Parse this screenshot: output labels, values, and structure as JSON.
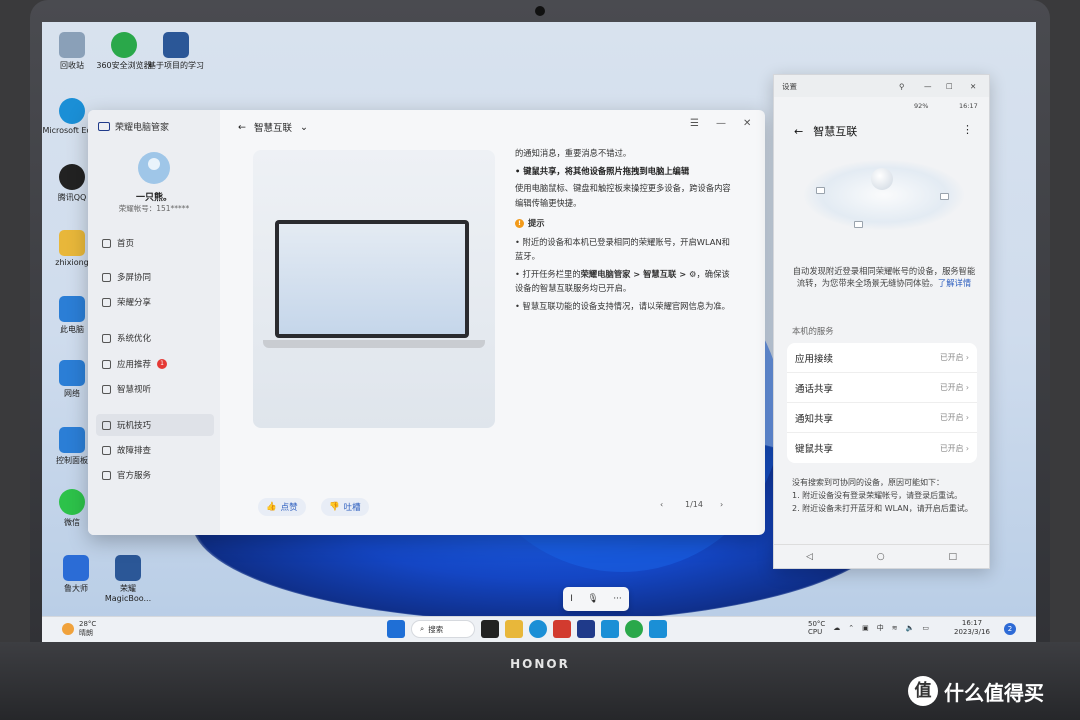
{
  "device": {
    "brand": "HONOR"
  },
  "desktop_icons": [
    {
      "label": "回收站",
      "icon": "recycle-bin-icon",
      "color": "#8aa0b8"
    },
    {
      "label": "360安全浏览器",
      "icon": "browser-icon",
      "color": "#2aa84a"
    },
    {
      "label": "基于项目的学习",
      "icon": "word-doc-icon",
      "color": "#2b5797"
    },
    {
      "label": "Microsoft Edge",
      "icon": "edge-icon",
      "color": "#1b8fd6"
    },
    {
      "label": "腾讯QQ",
      "icon": "qq-icon",
      "color": "#222"
    },
    {
      "label": "zhixiong",
      "icon": "folder-icon",
      "color": "#e8b73a"
    },
    {
      "label": "此电脑",
      "icon": "computer-icon",
      "color": "#2b7ed6"
    },
    {
      "label": "网络",
      "icon": "network-icon",
      "color": "#2b7ed6"
    },
    {
      "label": "控制面板",
      "icon": "control-panel-icon",
      "color": "#2b7ed6"
    },
    {
      "label": "微信",
      "icon": "wechat-icon",
      "color": "#2dc24a"
    },
    {
      "label": "鲁大师",
      "icon": "ludashi-icon",
      "color": "#2b6cd6"
    },
    {
      "label": "荣耀 MagicBoo...",
      "icon": "word-doc-icon",
      "color": "#2b5797"
    }
  ],
  "app": {
    "title": "荣耀电脑管家",
    "user_name": "一只熊。",
    "user_id": "荣耀帐号：151*****",
    "nav": [
      {
        "label": "首页",
        "icon": "home-icon"
      },
      {
        "label": "多屏协同",
        "icon": "multi-screen-icon"
      },
      {
        "label": "荣耀分享",
        "icon": "share-icon"
      },
      {
        "label": "系统优化",
        "icon": "optimize-icon"
      },
      {
        "label": "应用推荐",
        "icon": "apps-icon",
        "badge": "1"
      },
      {
        "label": "智慧视听",
        "icon": "audio-visual-icon"
      },
      {
        "label": "玩机技巧",
        "icon": "tips-icon",
        "active": true
      },
      {
        "label": "故障排查",
        "icon": "troubleshoot-icon"
      },
      {
        "label": "官方服务",
        "icon": "service-icon"
      }
    ],
    "header": "智慧互联",
    "article": {
      "line0": "的通知消息，重要消息不错过。",
      "heading": "键鼠共享，将其他设备照片拖拽到电脑上编辑",
      "body": "使用电脑鼠标、键盘和触控板来操控更多设备，跨设备内容编辑传输更快捷。",
      "tip_title": "提示",
      "tip1": "附近的设备和本机已登录相同的荣耀账号，开启WLAN和蓝牙。",
      "tip2_a": "打开任务栏里的",
      "tip2_b": "荣耀电脑管家 > 智慧互联 > ⚙",
      "tip2_c": "，确保该设备的智慧互联服务均已开启。",
      "tip3": "智慧互联功能的设备支持情况，请以荣耀官网信息为准。"
    },
    "like_label": "点赞",
    "dislike_label": "吐槽",
    "page": "1/14"
  },
  "settings": {
    "window_title": "设置",
    "battery": "92%",
    "time": "16:17",
    "title": "智慧互联",
    "desc": "自动发现附近登录相同荣耀帐号的设备，服务智能流转，为您带来全场景无缝协同体验。",
    "learn_more": "了解详情",
    "section": "本机的服务",
    "services": [
      {
        "label": "应用接续",
        "status": "已开启"
      },
      {
        "label": "通话共享",
        "status": "已开启"
      },
      {
        "label": "通知共享",
        "status": "已开启"
      },
      {
        "label": "键鼠共享",
        "status": "已开启"
      }
    ],
    "note_title": "没有搜索到可协同的设备，原因可能如下：",
    "note1": "1. 附近设备没有登录荣耀帐号，请登录后重试。",
    "note2": "2. 附近设备未打开蓝牙和 WLAN，请开启后重试。"
  },
  "taskbar": {
    "weather_temp": "28°C",
    "weather_text": "晴朗",
    "search_label": "搜索",
    "cpu_temp": "50°C",
    "cpu_label": "CPU",
    "time": "16:17",
    "date": "2023/3/16",
    "notifications": "2"
  },
  "watermark": {
    "badge": "值",
    "text": "什么值得买"
  }
}
